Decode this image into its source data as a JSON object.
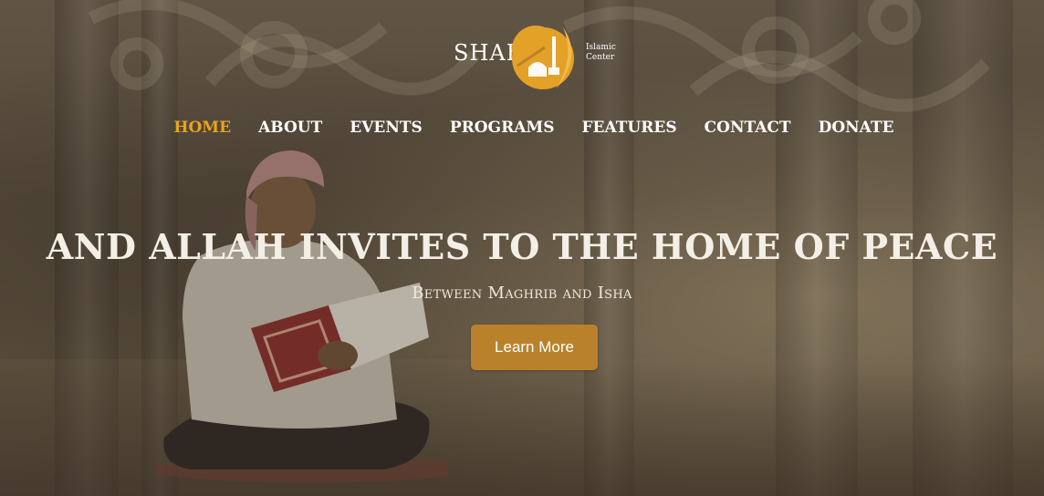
{
  "logo": {
    "name": "SHAHA",
    "sub_line1": "Islamic",
    "sub_line2": "Center",
    "mark_icon": "crescent-mosque-icon"
  },
  "nav": {
    "items": [
      "HOME",
      "ABOUT",
      "EVENTS",
      "PROGRAMS",
      "FEATURES",
      "CONTACT",
      "DONATE"
    ],
    "active": "HOME"
  },
  "hero": {
    "headline": "AND ALLAH INVITES TO THE HOME OF PEACE",
    "subline": "Between Maghrib and Isha",
    "cta_label": "Learn More"
  },
  "colors": {
    "accent": "#e9a21f",
    "button": "#b9822a",
    "text": "#ffffff"
  }
}
